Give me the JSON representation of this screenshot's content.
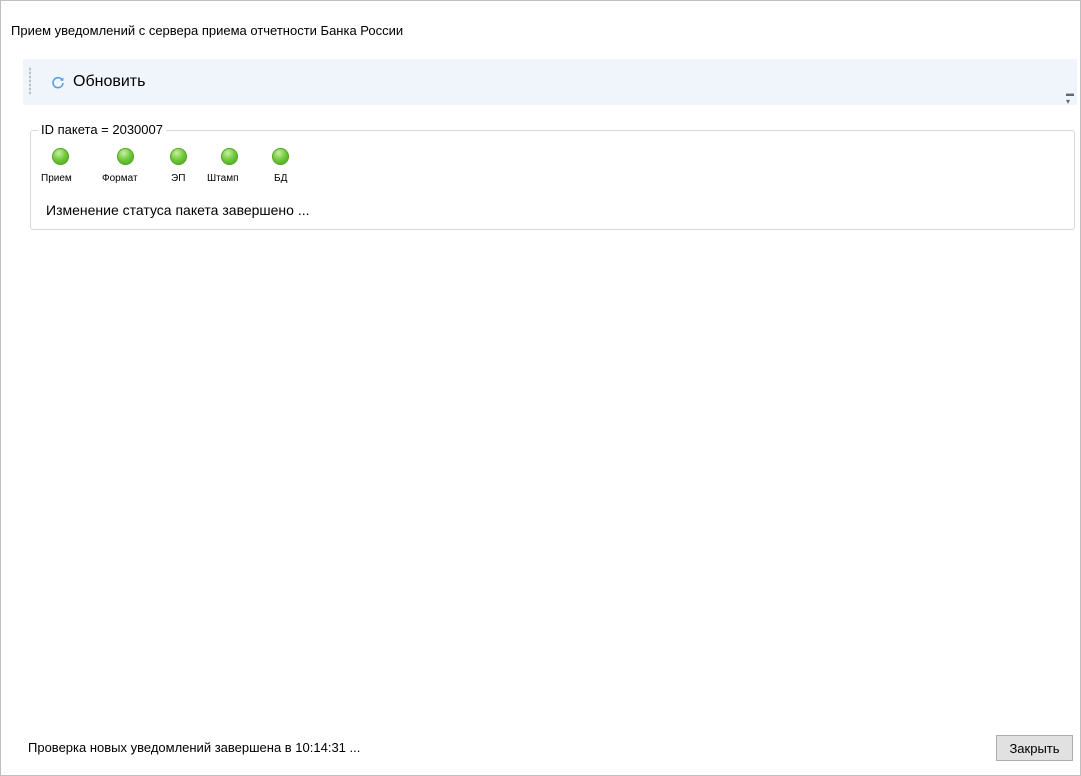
{
  "window": {
    "title": "Прием уведомлений с сервера приема отчетности Банка России"
  },
  "toolbar": {
    "refresh_label": "Обновить",
    "refresh_icon": "refresh-icon",
    "overflow_icon": "overflow-chevron-icon"
  },
  "package": {
    "legend": "ID пакета = 2030007",
    "indicators": [
      {
        "label": "Прием",
        "status": "ok",
        "color": "#6fc83a"
      },
      {
        "label": "Формат",
        "status": "ok",
        "color": "#6fc83a"
      },
      {
        "label": "ЭП",
        "status": "ok",
        "color": "#6fc83a"
      },
      {
        "label": "Штамп",
        "status": "ok",
        "color": "#6fc83a"
      },
      {
        "label": "БД",
        "status": "ok",
        "color": "#6fc83a"
      }
    ],
    "status_message": "Изменение статуса пакета завершено ..."
  },
  "footer": {
    "status_text": "Проверка новых уведомлений завершена в 10:14:31 ...",
    "close_label": "Закрыть"
  }
}
